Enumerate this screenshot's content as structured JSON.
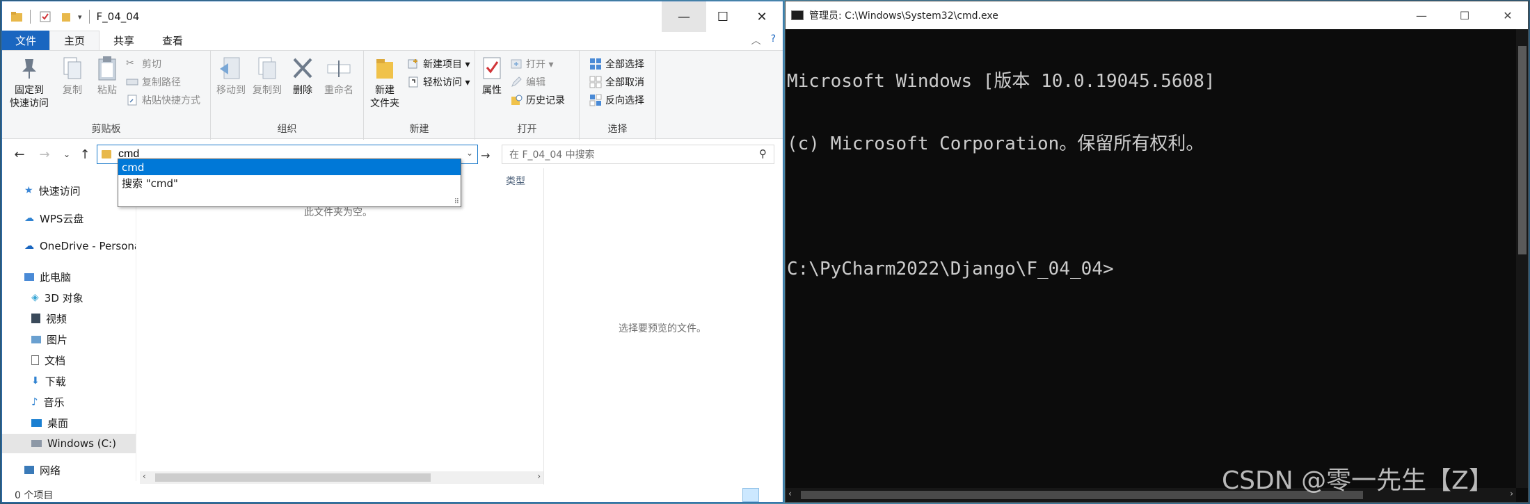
{
  "explorer": {
    "title": "F_04_04",
    "controls": {
      "minimize": "—",
      "maximize": "☐",
      "close": "✕"
    },
    "ribbon_tabs": [
      "文件",
      "主页",
      "共享",
      "查看"
    ],
    "active_tab": "主页",
    "groups": {
      "clipboard": {
        "label": "剪贴板",
        "pin": "固定到\n快速访问",
        "copy": "复制",
        "paste": "粘贴",
        "cut": "剪切",
        "copy_path": "复制路径",
        "paste_shortcut": "粘贴快捷方式"
      },
      "organize": {
        "label": "组织",
        "move_to": "移动到",
        "copy_to": "复制到",
        "delete": "删除",
        "rename": "重命名"
      },
      "new": {
        "label": "新建",
        "new_folder": "新建\n文件夹",
        "new_item": "新建项目 ▾",
        "easy_access": "轻松访问 ▾"
      },
      "open": {
        "label": "打开",
        "properties": "属性",
        "open": "打开 ▾",
        "edit": "编辑",
        "history": "历史记录"
      },
      "select": {
        "label": "选择",
        "select_all": "全部选择",
        "select_none": "全部取消",
        "invert": "反向选择"
      }
    },
    "address": {
      "value": "cmd"
    },
    "search": {
      "placeholder": "在 F_04_04 中搜索"
    },
    "autocomplete": [
      "cmd",
      "搜索 \"cmd\""
    ],
    "nav": {
      "quick_access": "快速访问",
      "wps": "WPS云盘",
      "onedrive": "OneDrive - Persona",
      "this_pc": "此电脑",
      "objects3d": "3D 对象",
      "videos": "视频",
      "pictures": "图片",
      "documents": "文档",
      "downloads": "下载",
      "music": "音乐",
      "desktop": "桌面",
      "windows_c": "Windows  (C:)",
      "network": "网络"
    },
    "content": {
      "column_type": "类型",
      "empty_message": "此文件夹为空。",
      "preview_message": "选择要预览的文件。"
    },
    "status": "0 个项目"
  },
  "cmd": {
    "title": "管理员: C:\\Windows\\System32\\cmd.exe",
    "controls": {
      "minimize": "—",
      "maximize": "☐",
      "close": "✕"
    },
    "lines": [
      "Microsoft Windows [版本 10.0.19045.5608]",
      "(c) Microsoft Corporation。保留所有权利。",
      "",
      "C:\\PyCharm2022\\Django\\F_04_04>"
    ]
  },
  "watermark": "CSDN @零一先生【Z】",
  "colors": {
    "accent": "#0078d7",
    "file_tab": "#1a66c0",
    "console_bg": "#0c0c0c",
    "console_fg": "#cccccc"
  }
}
